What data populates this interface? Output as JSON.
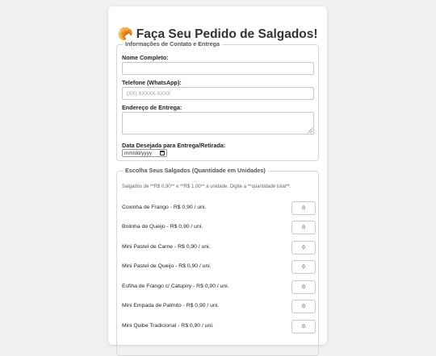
{
  "form": {
    "title": "Faça Seu Pedido de Salgados!",
    "title_emoji": "🥐"
  },
  "contact": {
    "legend": "Informações de Contato e Entrega",
    "name_label": "Nome Completo:",
    "name_value": "",
    "phone_label": "Telefone (WhatsApp):",
    "phone_placeholder": "(XX) XXXXX-XXXX",
    "address_label": "Endereço de Entrega:",
    "address_value": "",
    "date_label": "Data Desejada para Entrega/Retirada:",
    "date_placeholder": "mm/dd/yyyy"
  },
  "menu": {
    "legend": "Escolha Seus Salgados (Quantidade em Unidades)",
    "description": "Salgados de **R$ 0,90** e **R$ 1,00** a unidade. Digite a **quantidade total**.",
    "items": [
      {
        "label": "Coxinha de Frango - R$ 0,90 / uni.",
        "qty": "0"
      },
      {
        "label": "Bolinha de Queijo - R$ 0,90 / uni.",
        "qty": "0"
      },
      {
        "label": "Mini Pastel de Carne - R$ 0,90 / uni.",
        "qty": "0"
      },
      {
        "label": "Mini Pastel de Queijo - R$ 0,90 / uni.",
        "qty": "0"
      },
      {
        "label": "Esfiha de Frango c/ Catupiry - R$ 0,90 / uni.",
        "qty": "0"
      },
      {
        "label": "Mini Empada de Palmito - R$ 0,90 / uni.",
        "qty": "0"
      },
      {
        "label": "Mini Quibe Tradicional - R$ 0,90 / uni.",
        "qty": "0"
      }
    ]
  },
  "colors": {
    "background": "#f1f1f1",
    "card": "#ffffff",
    "border": "#d8d8d8",
    "text": "#333333",
    "emoji": "#d98a2b"
  }
}
